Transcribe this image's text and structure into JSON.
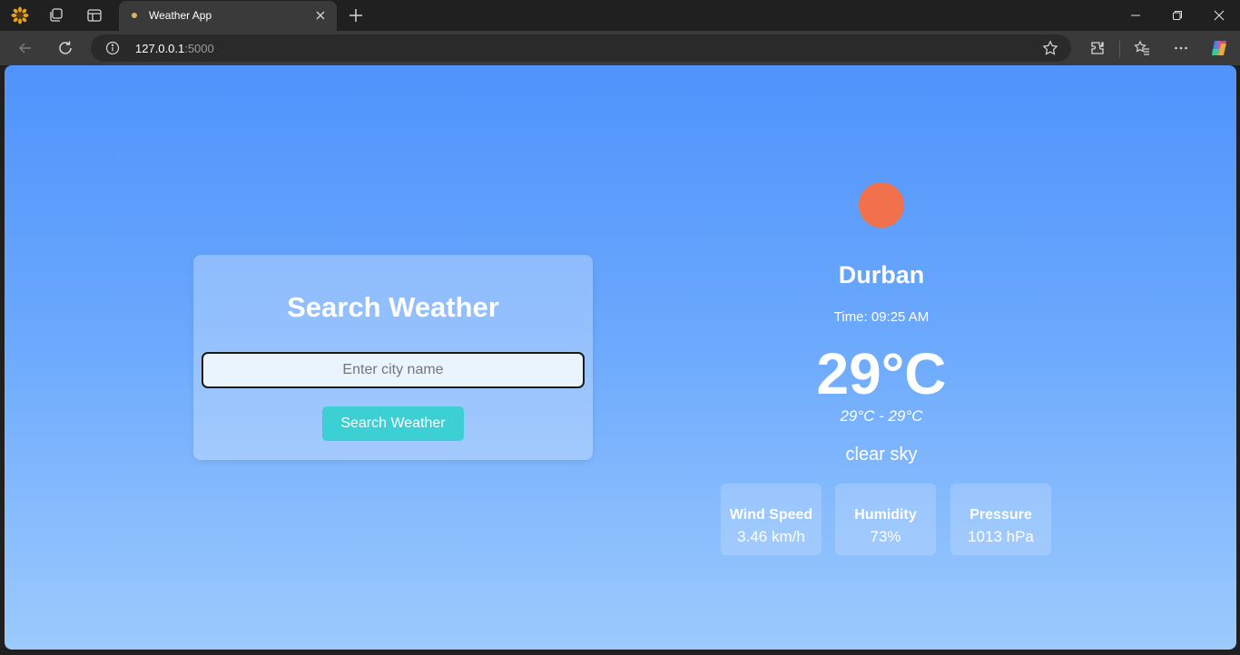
{
  "browser": {
    "tab_title": "Weather App",
    "url_host": "127.0.0.1",
    "url_port": ":5000",
    "icons": [
      "profile-sunflower-icon",
      "workspaces-icon",
      "tab-actions-icon",
      "favicon-icon",
      "close-icon",
      "new-tab-icon",
      "minimize-icon",
      "restore-icon",
      "window-close-icon",
      "back-icon",
      "refresh-icon",
      "info-icon",
      "star-icon",
      "extensions-icon",
      "favorites-icon",
      "more-icon",
      "copilot-icon"
    ]
  },
  "search": {
    "title": "Search Weather",
    "placeholder": "Enter city name",
    "button_label": "Search Weather",
    "accent_color": "#3ccfd3"
  },
  "weather": {
    "city": "Durban",
    "time": "Time: 09:25 AM",
    "temperature": "29°C",
    "range": "29°C - 29°C",
    "description": "clear sky",
    "sun_color": "#f0714c",
    "stats": [
      {
        "label": "Wind Speed",
        "value": "3.46 km/h"
      },
      {
        "label": "Humidity",
        "value": "73%"
      },
      {
        "label": "Pressure",
        "value": "1013 hPa"
      }
    ]
  }
}
